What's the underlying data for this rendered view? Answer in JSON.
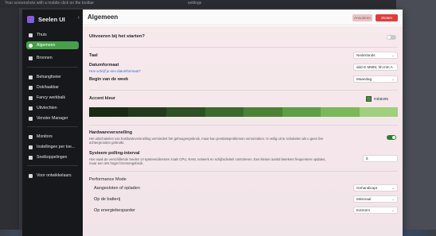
{
  "desktop": {
    "top_text": "Your screenshots with a mobile click on the toolbar",
    "top_text2": "settings"
  },
  "app": {
    "title": "Seelen UI"
  },
  "sidebar": {
    "items": [
      {
        "label": "Thuis",
        "icon": "home-icon"
      },
      {
        "label": "Algemeen",
        "icon": "settings-circle-icon",
        "active": true
      },
      {
        "label": "Bronnen",
        "icon": "resources-icon"
      },
      {
        "label": "Behangfoeier",
        "icon": "wallpaper-icon"
      },
      {
        "label": "Dok/taakbar",
        "icon": "dock-icon"
      },
      {
        "label": "Fancy werkbalk",
        "icon": "toolbar-icon"
      },
      {
        "label": "Uitvlechten",
        "icon": "tiling-icon"
      },
      {
        "label": "Venster Manager",
        "icon": "window-manager-icon"
      },
      {
        "label": "Monitors",
        "icon": "monitor-icon"
      },
      {
        "label": "Instellingen per toe...",
        "icon": "app-settings-icon"
      },
      {
        "label": "Snelkoppelingen",
        "icon": "shortcuts-icon"
      },
      {
        "label": "Voor ontwikkelaars",
        "icon": "developer-icon"
      }
    ]
  },
  "header": {
    "title": "Algemeen",
    "cancel_label": "Annuleren",
    "close_label": "Sluiten"
  },
  "settings": {
    "startup": {
      "label": "Uitvoeren bij het starten?",
      "enabled": false
    },
    "language": {
      "label": "Taal",
      "value": "Nederlands"
    },
    "date_format": {
      "label": "Datumformaat",
      "link": "Hoe schrijf je een datumformaat?",
      "value": "ddd D MMM, hh:mm A"
    },
    "week_start": {
      "label": "Begin van de week",
      "value": "Maandag"
    },
    "accent": {
      "label": "Accent kleur",
      "hex": "#4b8205",
      "palette": [
        "#1a2b14",
        "#233a1b",
        "#2e5024",
        "#3a6a2c",
        "#4b8235",
        "#5f9e44",
        "#7bb857",
        "#9fd07a"
      ]
    },
    "hw_accel": {
      "label": "Hardwareversnelling",
      "desc": "Het uitschakelen van hardwareversnelling vermindert het geheugengebruik, maar kan prestatieproblemen veroorzaken. Is veilig uit te schakelen als u geen live achtergronden gebruikt.",
      "enabled": true
    },
    "polling": {
      "label": "Systeem polling-interval",
      "desc": "Hoe vaak de verschillende Seelen UI systeemdiensten zoals CPU, RAM, netwerk en schijfactiviteit controleren. Een kleiner aantal betekent frequentere updates, maar een iets hoger bronnengebruik.",
      "value": "5"
    },
    "performance": {
      "label": "Performance Mode",
      "rows": [
        {
          "label": "Aangesloten of opladen",
          "value": "Gehandicapt"
        },
        {
          "label": "Op de batterij",
          "value": "Minimaal"
        },
        {
          "label": "Op energiebesparder",
          "value": "Extreem"
        }
      ]
    }
  }
}
